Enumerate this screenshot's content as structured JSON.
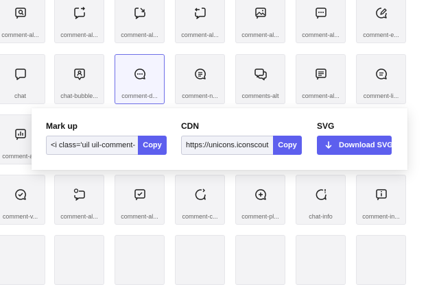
{
  "icons": {
    "r0c0": "comment-al...",
    "r0c1": "comment-al...",
    "r0c2": "comment-al...",
    "r0c3": "comment-al...",
    "r0c4": "comment-al...",
    "r0c5": "comment-al...",
    "r0c6": "comment-e...",
    "r1c0": "chat",
    "r1c1": "chat-bubble...",
    "r1c2": "comment-d...",
    "r1c3": "comment-n...",
    "r1c4": "comments-alt",
    "r1c5": "comment-al...",
    "r1c6": "comment-li...",
    "r2c0": "comment-a...",
    "r3c0": "comment-v...",
    "r3c1": "comment-al...",
    "r3c2": "comment-al...",
    "r3c3": "comment-c...",
    "r3c4": "comment-pl...",
    "r3c5": "chat-info",
    "r3c6": "comment-in..."
  },
  "panel": {
    "markup": {
      "title": "Mark up",
      "value": "<i class='uil uil-comment-",
      "copy_label": "Copy"
    },
    "cdn": {
      "title": "CDN",
      "value": "https://unicons.iconscout",
      "copy_label": "Copy"
    },
    "svg": {
      "title": "SVG",
      "download_label": "Download SVG"
    }
  },
  "colors": {
    "accent": "#5d5fee",
    "tile_bg": "#f3f3f5",
    "selected_border": "#6d6ee8"
  }
}
